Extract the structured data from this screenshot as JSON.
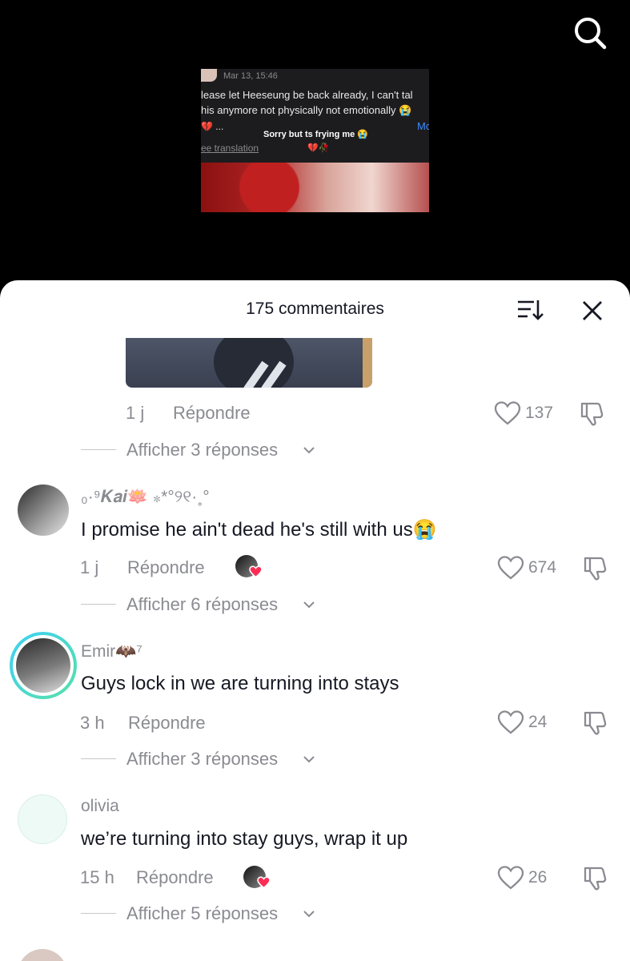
{
  "video": {
    "thumbnail": {
      "timestamp": "Mar 13, 15:46",
      "line1": "lease let Heeseung be back already, I can't tal",
      "line2": "his anymore not physically not emotionally 😭",
      "line3": "💔 ...",
      "more": "Mo",
      "translation": "ee translation",
      "overlay": "Sorry but ts frying me 😭",
      "overlay_hearts": "💔🥀"
    }
  },
  "sheet": {
    "title": "175 commentaires"
  },
  "comments": [
    {
      "time": "1 j",
      "reply": "Répondre",
      "likes": "137",
      "replies": "Afficher 3 réponses"
    },
    {
      "username": "₀·⁹𝑲𝒂𝒊🪷 ⁎*°୨୧·˳°",
      "text": "I promise he ain't dead he's still with us😭",
      "time": "1 j",
      "reply": "Répondre",
      "likes": "674",
      "replies": "Afficher 6 réponses"
    },
    {
      "username": "Emir🦇⁷",
      "text": "Guys lock in we are turning into stays",
      "time": "3 h",
      "reply": "Répondre",
      "likes": "24",
      "replies": "Afficher 3 réponses"
    },
    {
      "username": "olivia",
      "text": "we’re turning into stay guys, wrap it up",
      "time": "15 h",
      "reply": "Répondre",
      "likes": "26",
      "replies": "Afficher 5 réponses"
    }
  ],
  "colors": {
    "accent_like_heart": "#fe2c55",
    "muted_text": "#8a8b91",
    "primary_text": "#161823",
    "story_ring_start": "#3fd0f5",
    "story_ring_end": "#57e0a8"
  }
}
